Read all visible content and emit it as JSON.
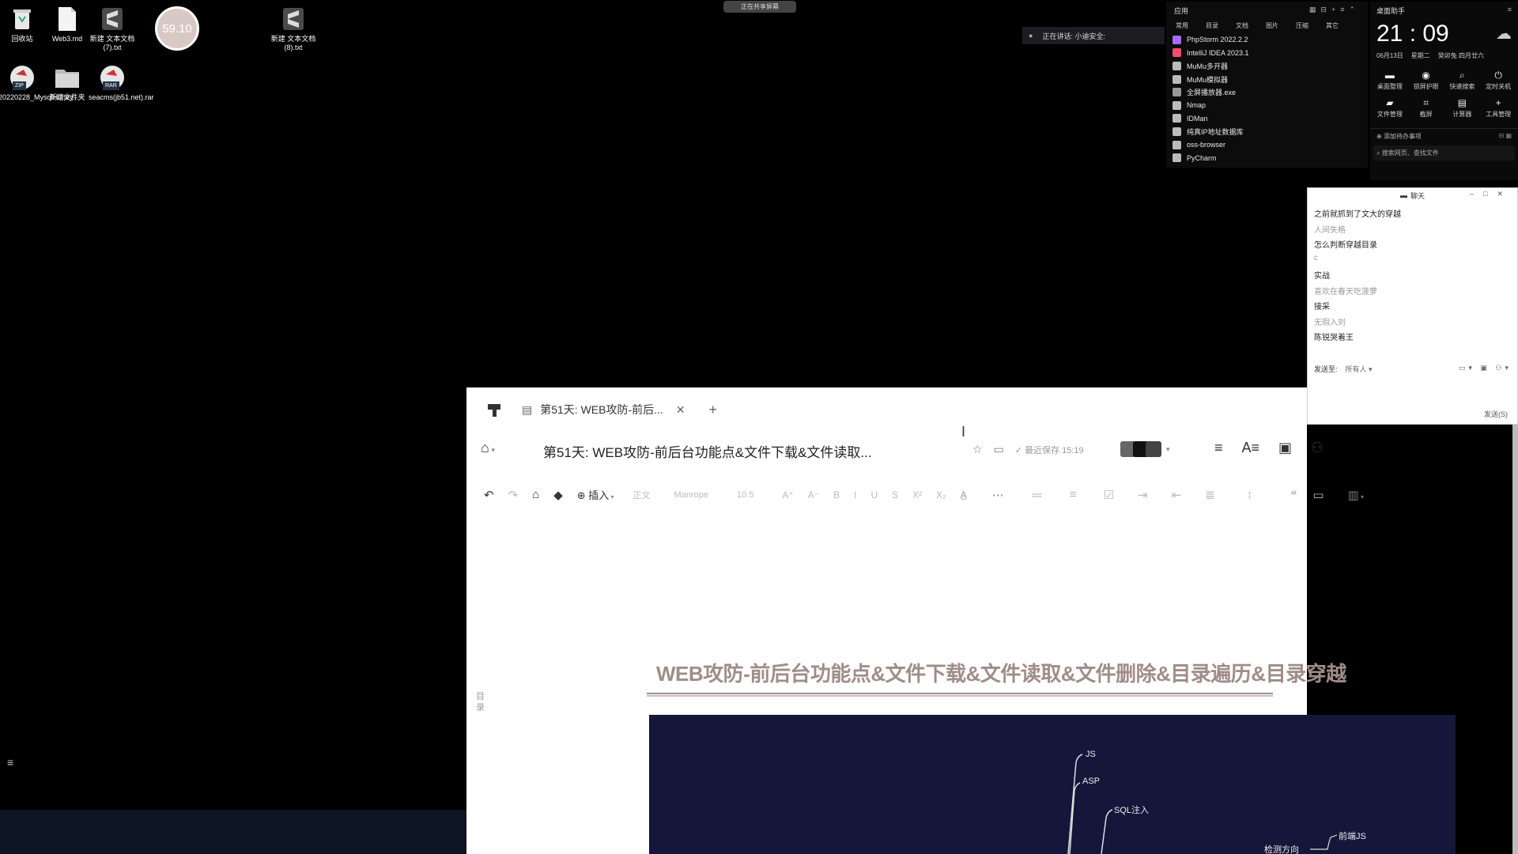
{
  "desktop_icons": [
    {
      "label": "回收站",
      "icon": "recycle-bin-icon"
    },
    {
      "label": "Web3.md",
      "icon": "markdown-file-icon"
    },
    {
      "label": "新建 文本文档 (7).txt",
      "icon": "sublime-file-icon"
    },
    {
      "label": "新建 文本文档 (8).txt",
      "icon": "sublime-file-icon"
    },
    {
      "label": "20220228_MysqlHoney...",
      "icon": "zip-icon",
      "badge": "ZIP"
    },
    {
      "label": "新建文件夹",
      "icon": "folder-icon"
    },
    {
      "label": "seacms(jb51.net).rar",
      "icon": "rar-icon",
      "badge": "RAR"
    }
  ],
  "widget_badge": "59.10",
  "meeting_notice": "正在共享屏幕",
  "speaking_bar": "正在讲话: 小迪安全:",
  "apps_panel": {
    "title": "应用",
    "tabs": [
      "常用",
      "目录",
      "文档",
      "图片",
      "压缩",
      "其它"
    ],
    "apps": [
      "PhpStorm 2022.2.2",
      "IntelliJ IDEA 2023.1",
      "MuMu多开器",
      "MuMu模拟器",
      "全屏播放器.exe",
      "Nmap",
      "IDMan",
      "纯真IP地址数据库",
      "oss-browser",
      "PyCharm"
    ]
  },
  "clock_panel": {
    "title": "桌面助手",
    "time": "21 : 09",
    "date": "06月13日",
    "weekday": "星期二",
    "lunar": "癸卯兔 四月廿六",
    "buttons1": [
      "桌面整理",
      "锁屏护眼",
      "快速搜索",
      "定时关机"
    ],
    "buttons2": [
      "文件管理",
      "截屏",
      "计算器",
      "工具管理"
    ],
    "todo": "添加待办事项",
    "search": "搜索网页、查找文件"
  },
  "chat": {
    "title": "聊天",
    "messages": [
      {
        "text": "之前就抓到了文大的穿越",
        "muted": false
      },
      {
        "text": "人间失格",
        "muted": true
      },
      {
        "text": "怎么判断穿越目录",
        "muted": false
      },
      {
        "text": "c",
        "muted": true
      },
      {
        "text": "实战",
        "muted": false
      },
      {
        "text": "喜欢在春天吃菠萝",
        "muted": true
      },
      {
        "text": "接采",
        "muted": false
      },
      {
        "text": "无瑕入刘",
        "muted": true
      },
      {
        "text": "陈锐哭着王",
        "muted": false
      }
    ],
    "send_to_label": "发送至:",
    "send_to_value": "所有人",
    "send_button": "发送(S)"
  },
  "doc": {
    "tab_title": "第51天: WEB攻防-前后...",
    "title": "第51天: WEB攻防-前后台功能点&文件下载&文件读取...",
    "saved": "最近保存 15:19",
    "toolbar_insert": "插入",
    "toolbar_style": "正文",
    "toolbar_font": "Manrope",
    "toolbar_size": "10.5",
    "toc": "目录",
    "heading": "WEB攻防-前后台功能点&文件下载&文件读取&文件删除&目录遍历&目录穿越",
    "mindmap": [
      "JS",
      "ASP",
      "SQL注入",
      "前端JS",
      "检测方向"
    ]
  }
}
